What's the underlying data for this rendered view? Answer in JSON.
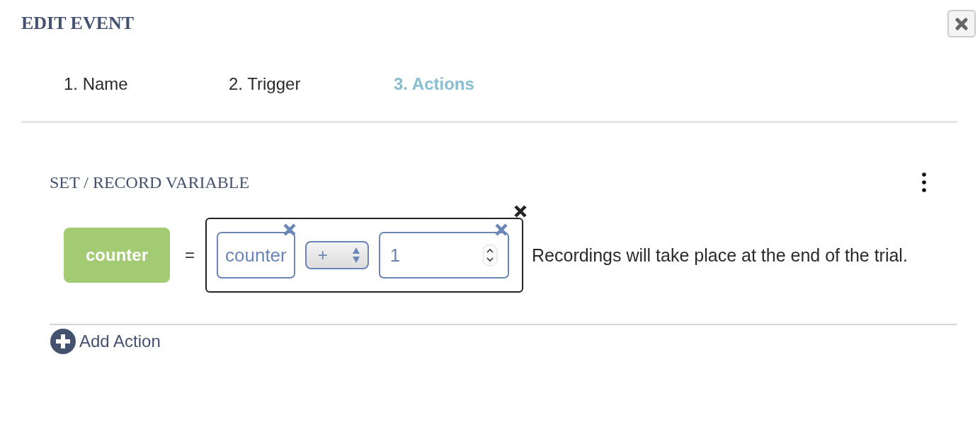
{
  "dialog": {
    "title": "EDIT EVENT"
  },
  "tabs": [
    {
      "label": "1. Name",
      "selected": false
    },
    {
      "label": "2. Trigger",
      "selected": false
    },
    {
      "label": "3. Actions",
      "selected": true
    }
  ],
  "action": {
    "title": "SET / RECORD VARIABLE",
    "variable": "counter",
    "assign": "=",
    "expression": {
      "operand": "counter",
      "operator": "+",
      "value": "1"
    },
    "note": "Recordings will take place at the end of the trial."
  },
  "add_action": "Add Action"
}
